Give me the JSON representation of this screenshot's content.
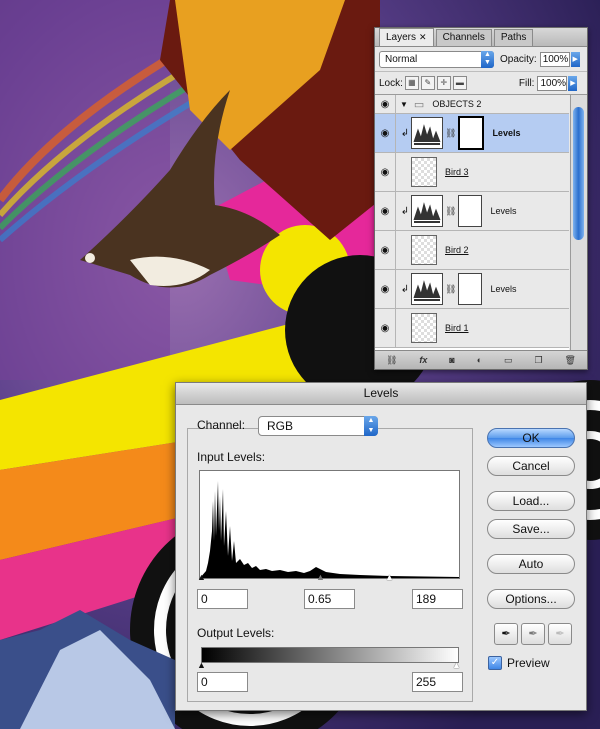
{
  "layers_panel": {
    "tabs": [
      {
        "label": "Layers",
        "close": "✕"
      },
      {
        "label": "Channels"
      },
      {
        "label": "Paths"
      }
    ],
    "blend_mode": "Normal",
    "opacity_label": "Opacity:",
    "opacity_value": "100%",
    "lock_label": "Lock:",
    "fill_label": "Fill:",
    "fill_value": "100%",
    "layers": [
      {
        "name": "OBJECTS 2",
        "kind": "group"
      },
      {
        "name": "Levels",
        "kind": "adjustment",
        "selected": true
      },
      {
        "name": "Bird 3",
        "kind": "pixel"
      },
      {
        "name": "Levels",
        "kind": "adjustment"
      },
      {
        "name": "Bird 2",
        "kind": "pixel"
      },
      {
        "name": "Levels",
        "kind": "adjustment"
      },
      {
        "name": "Bird 1",
        "kind": "pixel"
      }
    ],
    "footer_icons": [
      "link-icon",
      "fx-icon",
      "mask-icon",
      "adjustment-icon",
      "group-folder-icon",
      "new-layer-icon",
      "trash-icon"
    ],
    "footer_fx": "fx"
  },
  "levels_dialog": {
    "title": "Levels",
    "channel_label": "Channel:",
    "channel_value": "RGB",
    "input_levels_label": "Input Levels:",
    "input_black": "0",
    "input_gamma": "0.65",
    "input_white": "189",
    "output_levels_label": "Output Levels:",
    "output_black": "0",
    "output_white": "255",
    "buttons": {
      "ok": "OK",
      "cancel": "Cancel",
      "load": "Load...",
      "save": "Save...",
      "auto": "Auto",
      "options": "Options..."
    },
    "preview_label": "Preview",
    "preview_checked": true
  },
  "colors": {
    "accent_blue": "#3f86e6",
    "selection": "#b5ccf2"
  }
}
